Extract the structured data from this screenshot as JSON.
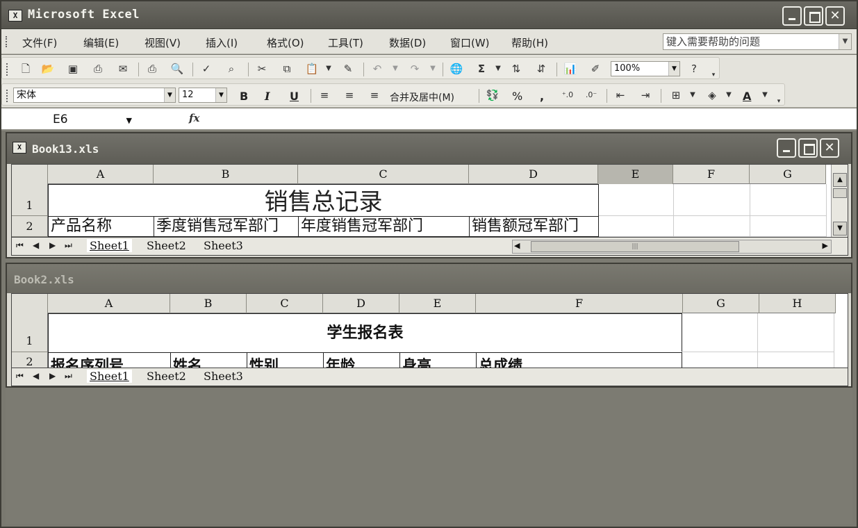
{
  "window": {
    "title": "Microsoft Excel",
    "app_icon": "X"
  },
  "menu": [
    "文件(F)",
    "编辑(E)",
    "视图(V)",
    "插入(I)",
    "格式(O)",
    "工具(T)",
    "数据(D)",
    "窗口(W)",
    "帮助(H)"
  ],
  "help_box": {
    "placeholder": "键入需要帮助的问题"
  },
  "standard_toolbar": {
    "zoom": "100%"
  },
  "formatting_toolbar": {
    "font": "宋体",
    "size": "12",
    "bold": "B",
    "italic": "I",
    "underline": "U",
    "merge_center": "合并及居中(M)",
    "percent": "%",
    "comma": ",",
    "font_color": "A"
  },
  "formula_bar": {
    "name_box": "E6",
    "fx": "fx",
    "value": ""
  },
  "book13": {
    "title": "Book13.xls",
    "icon": "X",
    "columns": [
      "A",
      "B",
      "C",
      "D",
      "E",
      "F",
      "G"
    ],
    "selected_column": "E",
    "rows": [
      "1",
      "2"
    ],
    "title_cell": "销售总记录",
    "headers": [
      "产品名称",
      "季度销售冠军部门",
      "年度销售冠军部门",
      "销售额冠军部门"
    ],
    "sheets": [
      "Sheet1",
      "Sheet2",
      "Sheet3"
    ]
  },
  "book2": {
    "title": "Book2.xls",
    "columns": [
      "A",
      "B",
      "C",
      "D",
      "E",
      "F",
      "G",
      "H"
    ],
    "rows": [
      "1",
      "2"
    ],
    "title_cell": "学生报名表",
    "headers": [
      "报名序列号",
      "姓名",
      "性别",
      "年龄",
      "身高",
      "总成绩"
    ],
    "sheets": [
      "Sheet1",
      "Sheet2",
      "Sheet3"
    ]
  }
}
